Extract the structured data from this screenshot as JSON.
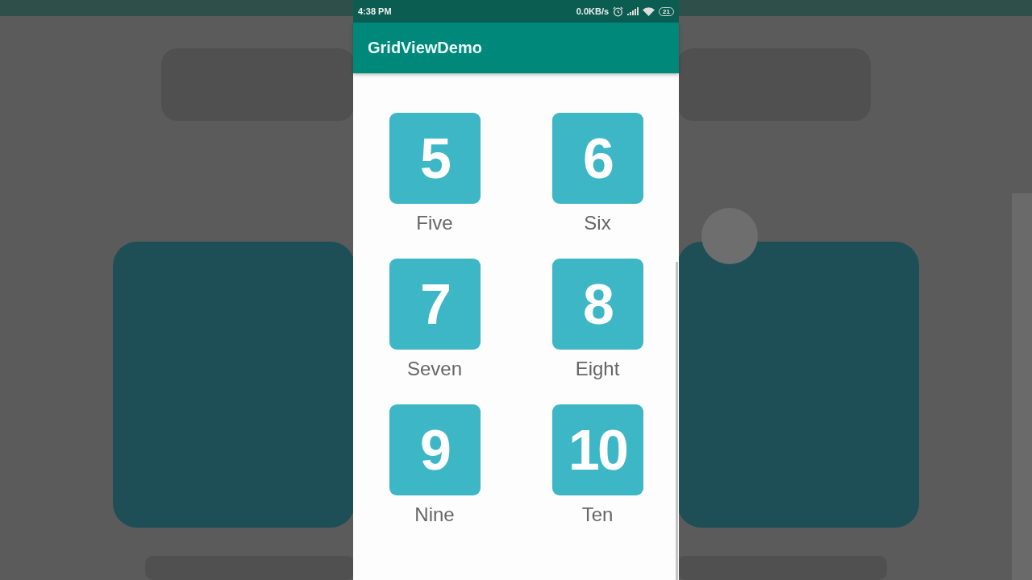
{
  "status_bar": {
    "time": "4:38 PM",
    "speed": "0.0KB/s",
    "battery": "21"
  },
  "app_bar": {
    "title": "GridViewDemo"
  },
  "grid": [
    {
      "number": "5",
      "label": "Five"
    },
    {
      "number": "6",
      "label": "Six"
    },
    {
      "number": "7",
      "label": "Seven"
    },
    {
      "number": "8",
      "label": "Eight"
    },
    {
      "number": "9",
      "label": "Nine"
    },
    {
      "number": "10",
      "label": "Ten"
    }
  ]
}
